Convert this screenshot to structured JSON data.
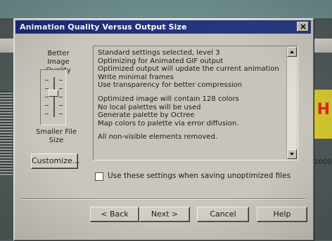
{
  "background": {
    "right_big_text": "H",
    "right_number": "1000"
  },
  "dialog": {
    "title": "Animation Quality Versus Output Size",
    "left": {
      "better_label_line1": "Better Image",
      "better_label_line2": "Quality",
      "smaller_label_line1": "Smaller File",
      "smaller_label_line2": "Size",
      "customize_label": "Customize..."
    },
    "details": {
      "lines_group1": [
        "Standard settings selected, level 3",
        "Optimizing for Animated GIF output",
        "Optimized output will update the current animation",
        "Write minimal frames",
        "Use transparency for better compression"
      ],
      "lines_group2": [
        "Optimized image will contain 128 colors",
        "No local palettes will be used",
        "Generate palette by Octree",
        "Map colors to palette via error diffusion."
      ],
      "lines_group3": [
        "All non-visible elements removed."
      ]
    },
    "checkbox": {
      "label": "Use these settings when saving unoptimized files",
      "checked": false
    },
    "buttons": {
      "back": "< Back",
      "next": "Next >",
      "cancel": "Cancel",
      "help": "Help"
    }
  }
}
